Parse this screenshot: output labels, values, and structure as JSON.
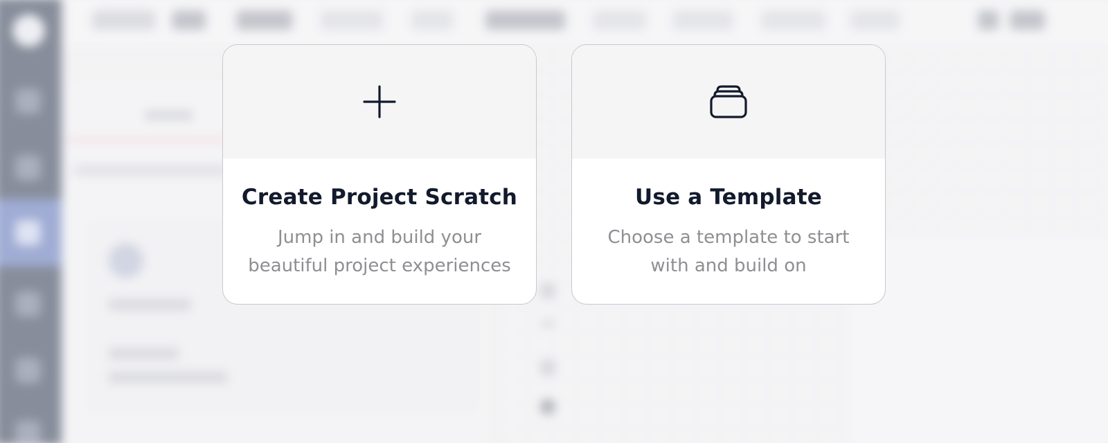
{
  "options": {
    "scratch": {
      "title": "Create Project Scratch",
      "description_line1": "Jump in and build your",
      "description_line2": "beautiful project experiences",
      "icon": "plus-icon"
    },
    "template": {
      "title": "Use a Template",
      "description_line1": "Choose a template to start",
      "description_line2": "with and build on",
      "icon": "stack-icon"
    }
  },
  "colors": {
    "title_text": "#121a2c",
    "description_text": "#8e8e93",
    "card_border": "#c7c8cc",
    "card_top_bg": "#f5f5f5",
    "sidebar_bg": "#2f3a50",
    "sidebar_active": "#5b72b8"
  }
}
